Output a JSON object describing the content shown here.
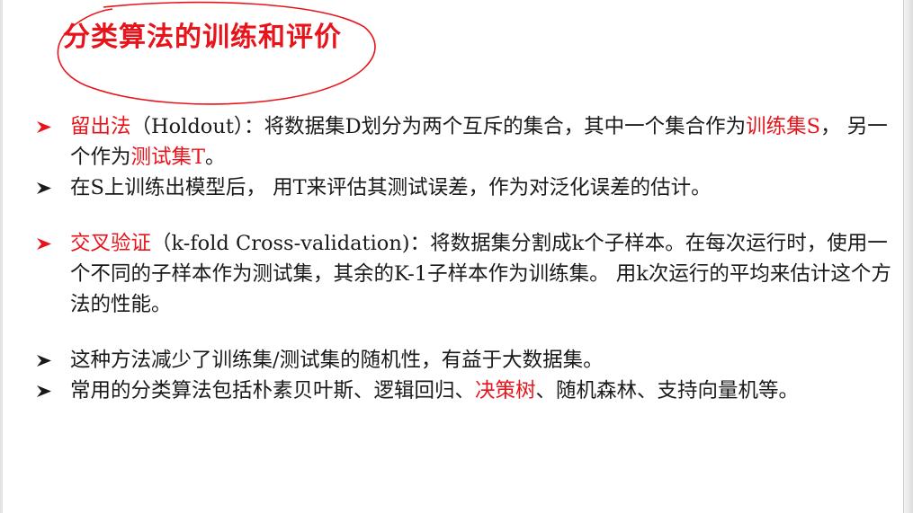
{
  "title": "分类算法的训练和评价",
  "bullets": [
    {
      "arrow_color": "#e8141b",
      "parts": [
        {
          "t": "留出法",
          "red": true
        },
        {
          "t": "（Holdout）：将数据集D划分为两个互斥的集合，其中一个集合作为"
        },
        {
          "t": "训练集S",
          "red": true
        },
        {
          "t": "，  另一个作为"
        },
        {
          "t": "测试集T",
          "red": true
        },
        {
          "t": "。"
        }
      ]
    },
    {
      "arrow_color": "#1a1a1a",
      "parts": [
        {
          "t": "在S上训练出模型后，  用T来评估其测试误差，作为对泛化误差的估计。"
        }
      ]
    },
    {
      "arrow_color": "#e8141b",
      "gap": true,
      "parts": [
        {
          "t": "交叉验证",
          "red": true
        },
        {
          "t": "（k-fold Cross-validation)：将数据集分割成k个子样本。在每次运行时，使用一个不同的子样本作为测试集，其余的K-1子样本作为训练集。  用k次运行的平均来估计这个方法的性能。"
        }
      ]
    },
    {
      "arrow_color": "#1a1a1a",
      "gap": true,
      "parts": [
        {
          "t": "这种方法减少了训练集/测试集的随机性，有益于大数据集。"
        }
      ]
    },
    {
      "arrow_color": "#1a1a1a",
      "parts": [
        {
          "t": "常用的分类算法包括朴素贝叶斯、逻辑回归、"
        },
        {
          "t": "决策树",
          "red": true
        },
        {
          "t": "、随机森林、支持向量机等。"
        }
      ]
    }
  ]
}
